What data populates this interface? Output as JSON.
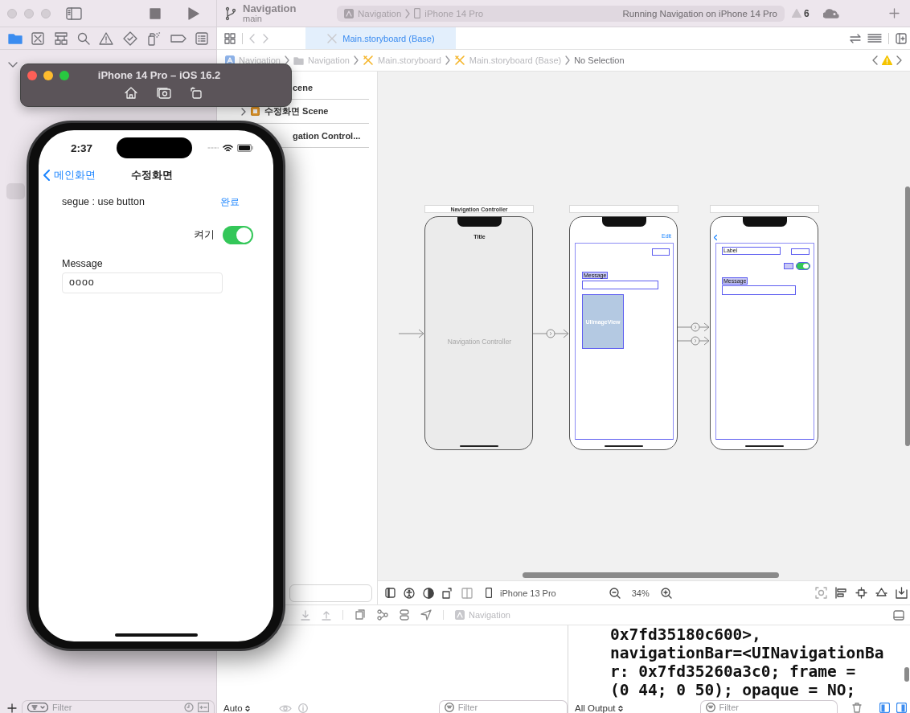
{
  "toolbar": {
    "project": "Navigation",
    "branch": "main",
    "scheme": "Navigation",
    "device": "iPhone 14 Pro",
    "status": "Running Navigation on iPhone 14 Pro",
    "warnings": "6"
  },
  "navigator_tabs": [
    {
      "kind": "folder",
      "selected": true
    },
    {
      "kind": "xbox",
      "selected": false
    },
    {
      "kind": "hierarchy",
      "selected": false
    },
    {
      "kind": "search",
      "selected": false
    },
    {
      "kind": "warning",
      "selected": false
    },
    {
      "kind": "diamond",
      "selected": false
    },
    {
      "kind": "spray",
      "selected": false
    },
    {
      "kind": "tag",
      "selected": false
    },
    {
      "kind": "list",
      "selected": false
    }
  ],
  "navigator_filter": {
    "placeholder": "Filter"
  },
  "editor_tabs": [
    {
      "label": "Main.storyboard (Base)",
      "selected": true
    }
  ],
  "breadcrumb": [
    {
      "label": "Navigation",
      "kind": "app"
    },
    {
      "label": "Navigation",
      "kind": "folder"
    },
    {
      "label": "Main.storyboard",
      "kind": "storyboard"
    },
    {
      "label": "Main.storyboard (Base)",
      "kind": "storyboard"
    },
    {
      "label": "No Selection",
      "kind": "plain"
    }
  ],
  "outline": [
    {
      "label": "cene",
      "kind": "text"
    },
    {
      "label": "수정화면 Scene",
      "kind": "scene"
    },
    {
      "label": "gation Control...",
      "kind": "text"
    }
  ],
  "scenes": [
    {
      "kind": "navigation",
      "header": "Navigation Controller",
      "title": "Title",
      "caption": "Navigation Controller"
    },
    {
      "kind": "main",
      "right_item": "Edit",
      "label": "Message",
      "image": "UIImageView"
    },
    {
      "kind": "edit",
      "label": "Label",
      "switch_on": true,
      "field_label": "Message"
    }
  ],
  "canvas_bar": {
    "device": "iPhone 13 Pro",
    "zoom": "34%"
  },
  "debug_bar": {
    "target": "Navigation"
  },
  "console": {
    "lines": [
      "0x7fd35180c600>,",
      "navigationBar=<UINavigationBa",
      "r: 0x7fd35260a3c0; frame =",
      "(0 44; 0 50); opaque = NO;"
    ]
  },
  "debug_footer": {
    "scope": "Auto",
    "variables_filter": {
      "placeholder": "Filter"
    },
    "output": "All Output",
    "console_filter": {
      "placeholder": "Filter"
    }
  },
  "simulator": {
    "title": "iPhone 14 Pro – iOS 16.2",
    "time": "2:37",
    "back": "메인화면",
    "nav_title": "수정화면",
    "label": "segue : use button",
    "done": "완료",
    "switch_label": "켜기",
    "switch_on": true,
    "message_label": "Message",
    "message_value": "oooo"
  }
}
